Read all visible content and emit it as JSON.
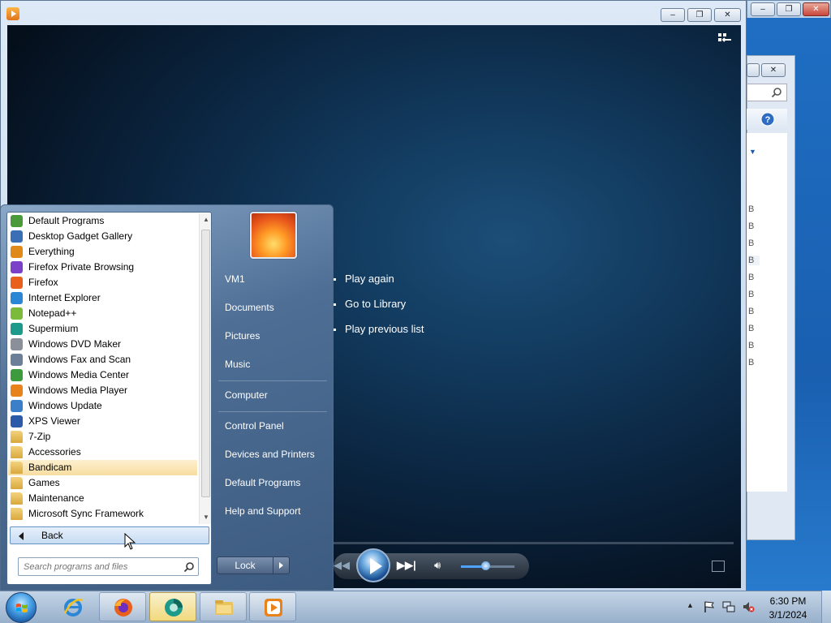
{
  "background_window": {
    "list_suffix": [
      "B",
      "B",
      "B",
      "B",
      "B",
      "B",
      "B",
      "B",
      "B",
      "B"
    ]
  },
  "wmp": {
    "caption_buttons": {
      "minimize": "–",
      "maximize": "□",
      "close": "✕"
    },
    "options": [
      "Play again",
      "Go to Library",
      "Play previous list"
    ],
    "volume_level": 0.45
  },
  "start_menu": {
    "programs": [
      {
        "label": "Default Programs",
        "icon": "default-programs-icon",
        "color": "#4a9a3a"
      },
      {
        "label": "Desktop Gadget Gallery",
        "icon": "gadget-icon",
        "color": "#3a6fb5"
      },
      {
        "label": "Everything",
        "icon": "magnifier-icon",
        "color": "#e08a1a"
      },
      {
        "label": "Firefox Private Browsing",
        "icon": "firefox-private-icon",
        "color": "#7b3fc8"
      },
      {
        "label": "Firefox",
        "icon": "firefox-icon",
        "color": "#e8601c"
      },
      {
        "label": "Internet Explorer",
        "icon": "ie-icon",
        "color": "#2c86d6"
      },
      {
        "label": "Notepad++",
        "icon": "notepadpp-icon",
        "color": "#7cba3c"
      },
      {
        "label": "Supermium",
        "icon": "supermium-icon",
        "color": "#1d9a8a"
      },
      {
        "label": "Windows DVD Maker",
        "icon": "dvd-maker-icon",
        "color": "#8a8f99"
      },
      {
        "label": "Windows Fax and Scan",
        "icon": "fax-icon",
        "color": "#6b7f99"
      },
      {
        "label": "Windows Media Center",
        "icon": "media-center-icon",
        "color": "#3d9b3d"
      },
      {
        "label": "Windows Media Player",
        "icon": "media-player-icon",
        "color": "#e8831c"
      },
      {
        "label": "Windows Update",
        "icon": "update-icon",
        "color": "#3a7fc8"
      },
      {
        "label": "XPS Viewer",
        "icon": "xps-icon",
        "color": "#2a5aa8"
      },
      {
        "label": "7-Zip",
        "icon": "folder-icon",
        "color": "folder"
      },
      {
        "label": "Accessories",
        "icon": "folder-icon",
        "color": "folder"
      },
      {
        "label": "Bandicam",
        "icon": "folder-icon",
        "color": "folder",
        "highlighted": true
      },
      {
        "label": "Games",
        "icon": "folder-icon",
        "color": "folder"
      },
      {
        "label": "Maintenance",
        "icon": "folder-icon",
        "color": "folder"
      },
      {
        "label": "Microsoft Sync Framework",
        "icon": "folder-icon",
        "color": "folder"
      }
    ],
    "back_label": "Back",
    "search_placeholder": "Search programs and files",
    "right_items": [
      "VM1",
      "Documents",
      "Pictures",
      "Music",
      "Computer",
      "Control Panel",
      "Devices and Printers",
      "Default Programs",
      "Help and Support"
    ],
    "lock_label": "Lock"
  },
  "taskbar": {
    "clock_time": "6:30 PM",
    "clock_date": "3/1/2024"
  }
}
